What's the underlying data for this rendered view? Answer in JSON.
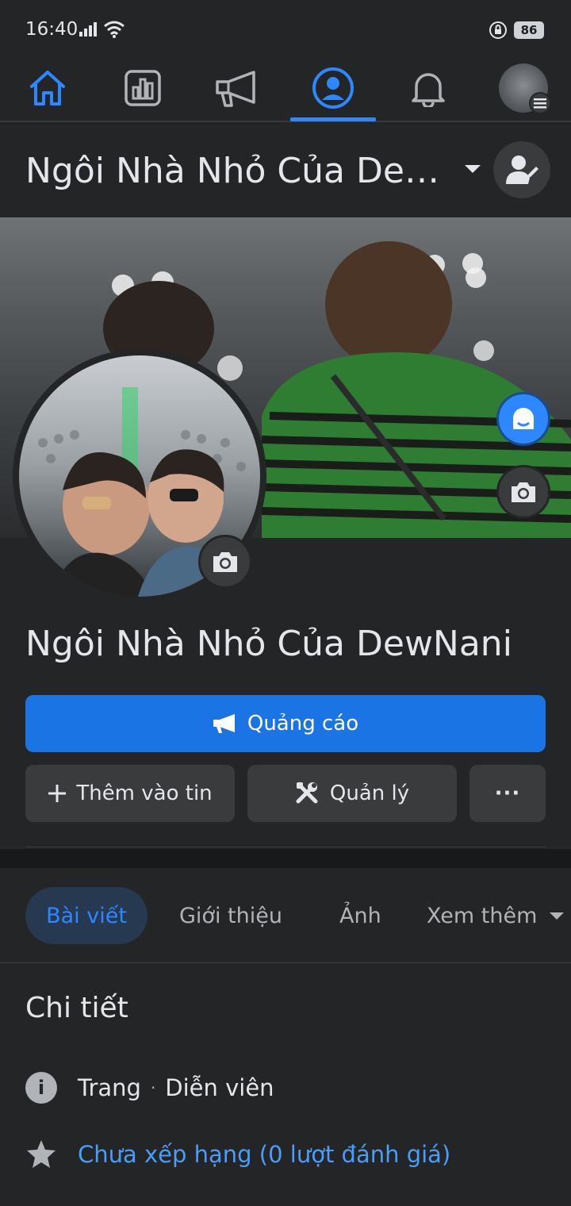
{
  "status_bar": {
    "time": "16:40",
    "battery": "86"
  },
  "nav": {
    "items": [
      {
        "name": "home-icon",
        "active": false
      },
      {
        "name": "insights-icon",
        "active": false
      },
      {
        "name": "ads-icon",
        "active": false
      },
      {
        "name": "page-profile-icon",
        "active": true
      },
      {
        "name": "notifications-icon",
        "active": false
      },
      {
        "name": "account-menu-avatar",
        "active": false
      }
    ],
    "accent": "#2d88ff"
  },
  "header": {
    "page_title": "Ngôi Nhà Nhỏ Của Dew..."
  },
  "profile": {
    "name": "Ngôi Nhà Nhỏ Của DewNani"
  },
  "actions": {
    "advertise_label": "Quảng cáo",
    "add_to_story_label": "Thêm vào tin",
    "manage_label": "Quản lý",
    "more_label": "···"
  },
  "tabs": [
    {
      "label": "Bài viết",
      "active": true
    },
    {
      "label": "Giới thiệu",
      "active": false
    },
    {
      "label": "Ảnh",
      "active": false
    },
    {
      "label": "Xem thêm",
      "active": false
    }
  ],
  "details": {
    "heading": "Chi tiết",
    "page_type": "Trang",
    "separator": "·",
    "category": "Diễn viên",
    "rating": "Chưa xếp hạng (0 lượt đánh giá)"
  },
  "colors": {
    "background": "#242526",
    "primary_button": "#1b74e4",
    "secondary_button": "#3a3b3c",
    "link": "#4a9df8"
  }
}
